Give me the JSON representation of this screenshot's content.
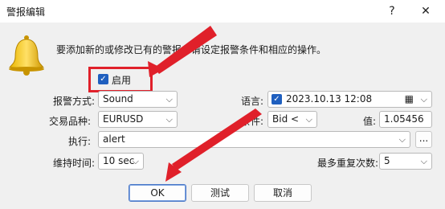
{
  "dialog": {
    "title": "警报编辑",
    "help": "?",
    "close": "✕",
    "description": "要添加新的或修改已有的警报，请设定报警条件和相应的操作。"
  },
  "enable": {
    "label": "启用",
    "checked": true
  },
  "fields": {
    "alert_type_label": "报警方式:",
    "alert_type_value": "Sound",
    "language_label": "语言:",
    "datetime_checked": true,
    "datetime_value": "2023.10.13 12:08",
    "symbol_label": "交易品种:",
    "symbol_value": "EURUSD",
    "condition_label": "条件:",
    "condition_value": "Bid <",
    "value_label": "值:",
    "value_value": "1.05456",
    "execute_label": "执行:",
    "execute_value": "alert",
    "execute_browse": "...",
    "timeout_label": "维持时间:",
    "timeout_value": "10 sec",
    "max_repeat_label": "最多重复次数:",
    "max_repeat_value": "5"
  },
  "buttons": {
    "ok": "OK",
    "test": "测试",
    "cancel": "取消"
  },
  "colors": {
    "accent": "#1f5fbf",
    "annotation": "#e0202a"
  }
}
